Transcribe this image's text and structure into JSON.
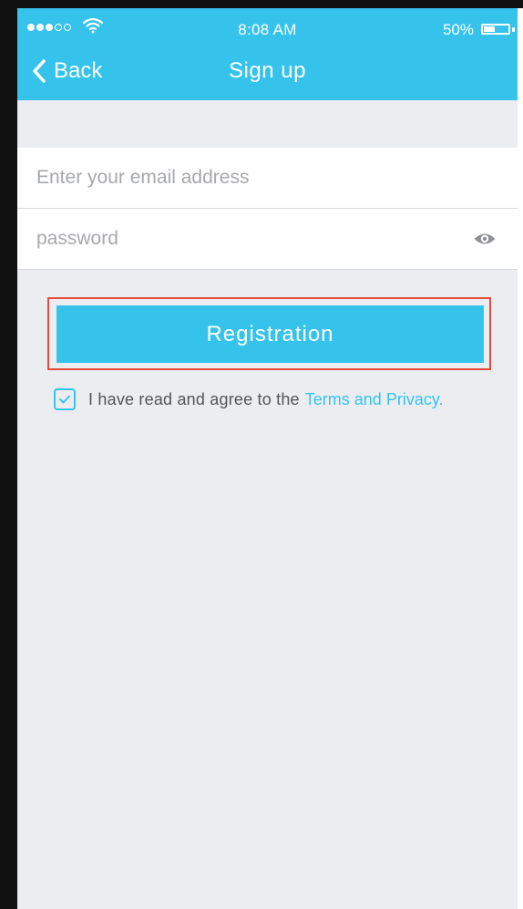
{
  "status_bar": {
    "time": "8:08 AM",
    "battery_percent": "50%",
    "signal_bars_filled": 3,
    "signal_bars_total": 5
  },
  "nav": {
    "back_label": "Back",
    "title": "Sign up"
  },
  "form": {
    "email": {
      "placeholder": "Enter your email address",
      "value": ""
    },
    "password": {
      "placeholder": "password",
      "value": ""
    }
  },
  "actions": {
    "register_label": "Registration"
  },
  "agreement": {
    "checked": true,
    "text": "I have read and agree to the",
    "link_text": "Terms and Privacy."
  },
  "icons": {
    "back": "chevron-left-icon",
    "eye": "eye-icon",
    "wifi": "wifi-icon",
    "battery": "battery-icon",
    "check": "check-icon"
  },
  "colors": {
    "accent": "#35c3ec",
    "background": "#ecedf1",
    "highlight_border": "#e54b3c",
    "placeholder": "#a7a8ac"
  }
}
